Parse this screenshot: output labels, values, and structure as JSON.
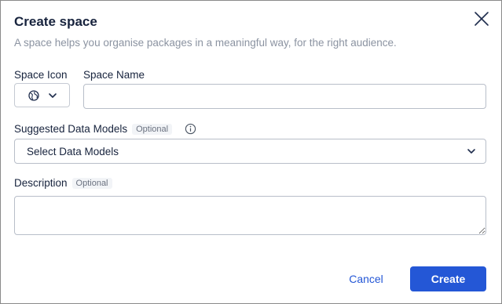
{
  "dialog": {
    "title": "Create space",
    "subtitle": "A space helps you organise packages in a meaningful way, for the right audience."
  },
  "fields": {
    "space_icon_label": "Space Icon",
    "space_name_label": "Space Name",
    "space_name_value": "",
    "data_models_label": "Suggested Data Models",
    "data_models_optional": "Optional",
    "data_models_placeholder": "Select Data Models",
    "description_label": "Description",
    "description_optional": "Optional",
    "description_value": ""
  },
  "buttons": {
    "cancel": "Cancel",
    "create": "Create"
  },
  "icons": {
    "close": "close-icon",
    "space_icon": "globe-icon",
    "chevron": "chevron-down-icon",
    "info": "info-icon"
  },
  "colors": {
    "primary": "#2457d6",
    "title": "#17233d",
    "subtitle": "#8b93a1"
  }
}
